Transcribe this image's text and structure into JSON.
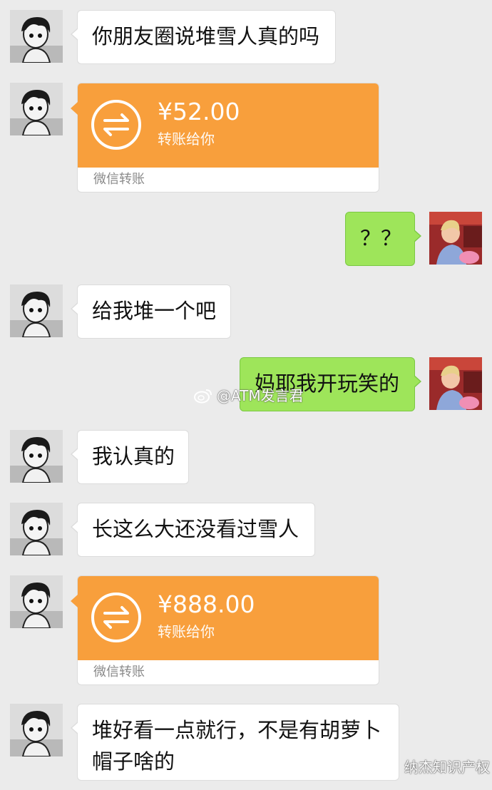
{
  "messages": [
    {
      "sender": "friend",
      "type": "text",
      "text": "你朋友圈说堆雪人真的吗"
    },
    {
      "sender": "friend",
      "type": "transfer",
      "amount": "¥52.00",
      "subtitle": "转账给你",
      "footer": "微信转账"
    },
    {
      "sender": "me",
      "type": "text",
      "text": "？？"
    },
    {
      "sender": "friend",
      "type": "text",
      "text": "给我堆一个吧"
    },
    {
      "sender": "me",
      "type": "text",
      "text": "妈耶我开玩笑的"
    },
    {
      "sender": "friend",
      "type": "text",
      "text": "我认真的"
    },
    {
      "sender": "friend",
      "type": "text",
      "text": "长这么大还没看过雪人"
    },
    {
      "sender": "friend",
      "type": "transfer",
      "amount": "¥888.00",
      "subtitle": "转账给你",
      "footer": "微信转账"
    },
    {
      "sender": "friend",
      "type": "text",
      "text": "堆好看一点就行，不是有胡萝卜帽子啥的"
    }
  ],
  "watermark": {
    "text": "@ATM发言君",
    "icon": "weibo-icon"
  },
  "credit": {
    "text": "纳杰知识产权",
    "icon": "wechat-official-account-icon"
  },
  "colors": {
    "background": "#ebebeb",
    "my_bubble": "#9ee55a",
    "transfer": "#f89f3c"
  }
}
